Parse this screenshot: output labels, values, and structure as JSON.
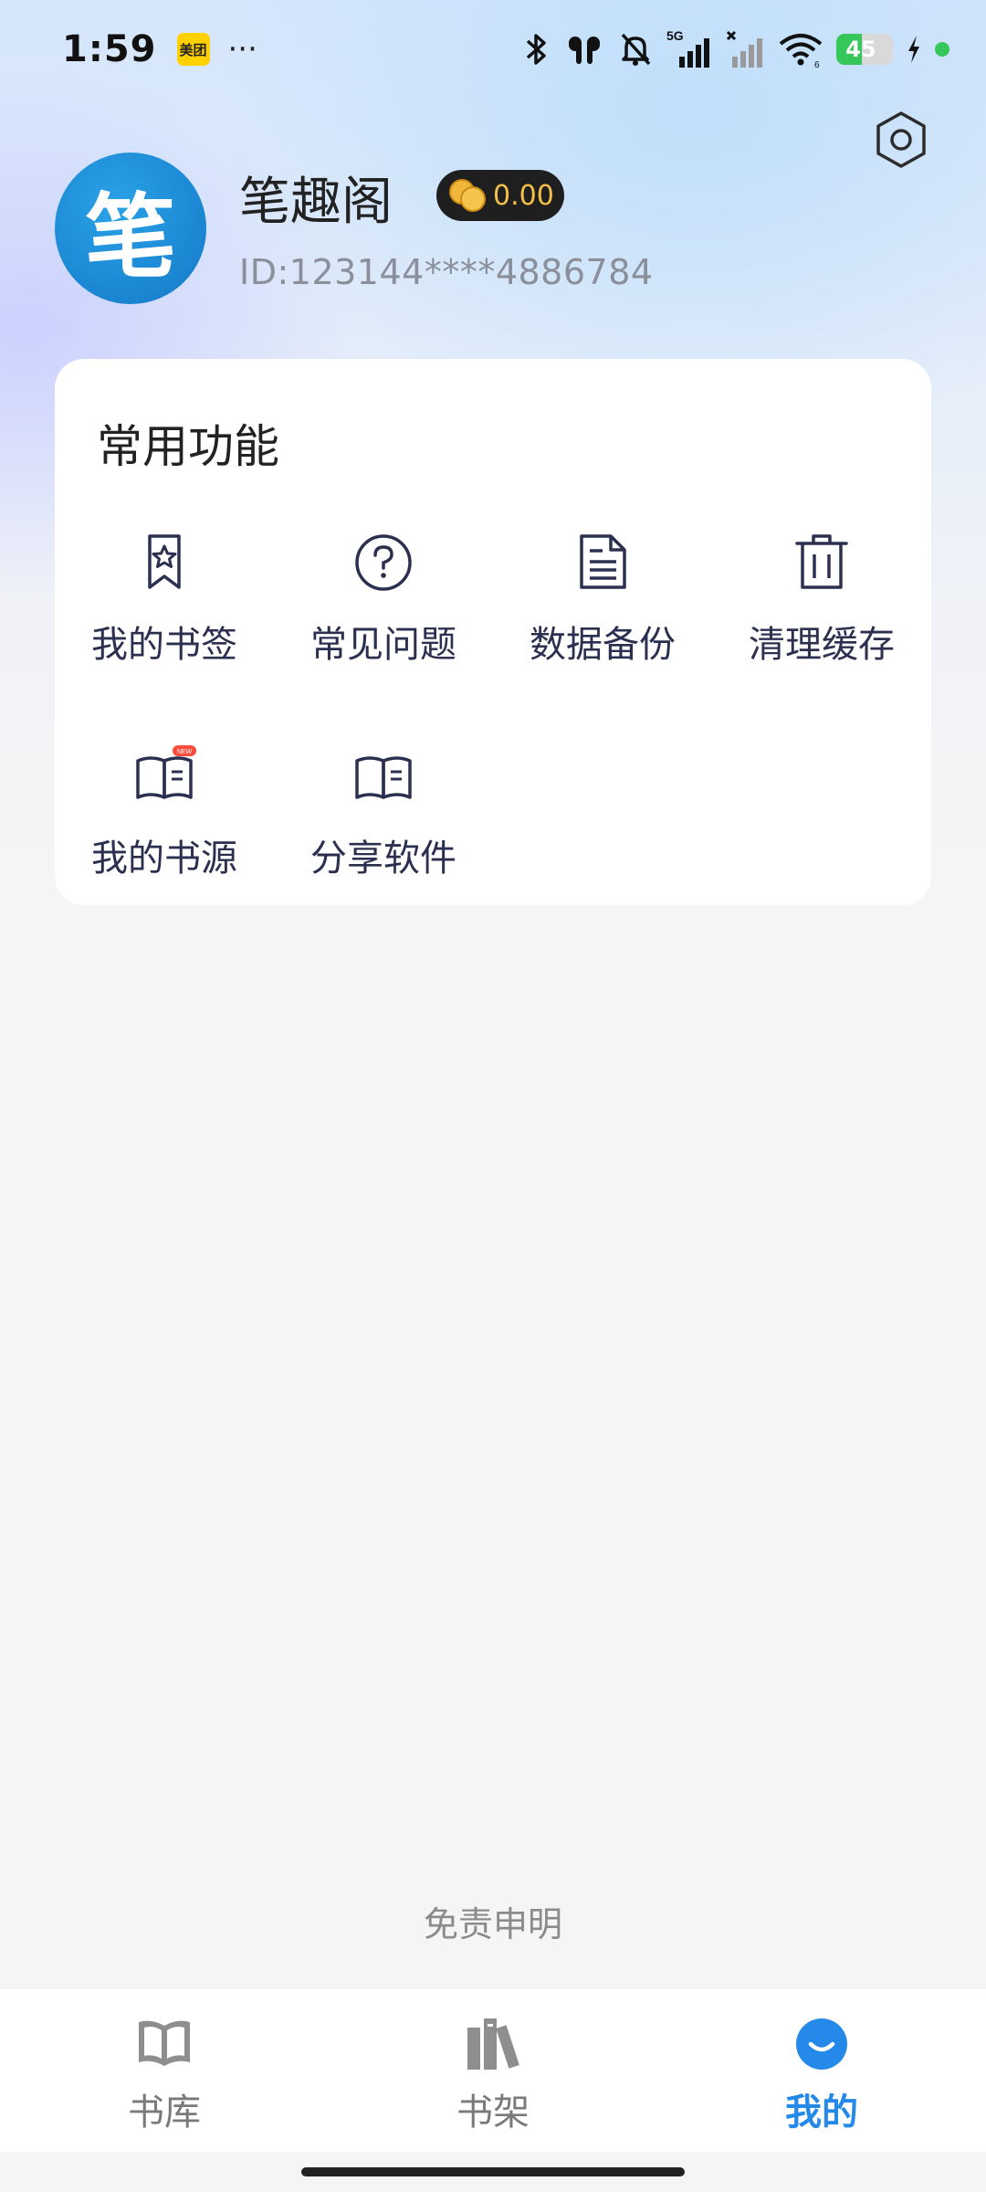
{
  "status_bar": {
    "time": "1:59",
    "app_badge": "美团",
    "more": "···",
    "network": "5G",
    "battery": "45",
    "battery_level": 0.45,
    "icons": [
      "bluetooth-icon",
      "earbuds-icon",
      "mute-icon",
      "signal-5g-icon",
      "signal-off-icon",
      "wifi-icon",
      "battery-icon",
      "charging-icon"
    ]
  },
  "header": {
    "settings_icon": "hexagon-settings-icon"
  },
  "profile": {
    "avatar_char": "笔",
    "username": "笔趣阁",
    "coins": "0.00",
    "user_id": "ID:123144****4886784"
  },
  "functions": {
    "title": "常用功能",
    "items": [
      {
        "label": "我的书签",
        "icon": "bookmark-star-icon"
      },
      {
        "label": "常见问题",
        "icon": "question-circle-icon"
      },
      {
        "label": "数据备份",
        "icon": "document-icon"
      },
      {
        "label": "清理缓存",
        "icon": "trash-icon"
      },
      {
        "label": "我的书源",
        "icon": "book-source-icon"
      },
      {
        "label": "分享软件",
        "icon": "open-book-icon"
      }
    ]
  },
  "disclaimer": "免责申明",
  "bottom_nav": {
    "items": [
      {
        "label": "书库",
        "icon": "book-library-icon",
        "active": false
      },
      {
        "label": "书架",
        "icon": "bookshelf-icon",
        "active": false
      },
      {
        "label": "我的",
        "icon": "profile-smile-icon",
        "active": true
      }
    ]
  },
  "colors": {
    "accent": "#2489e8",
    "icon_stroke": "#2c3050",
    "coin_gold": "#f5c04a"
  }
}
